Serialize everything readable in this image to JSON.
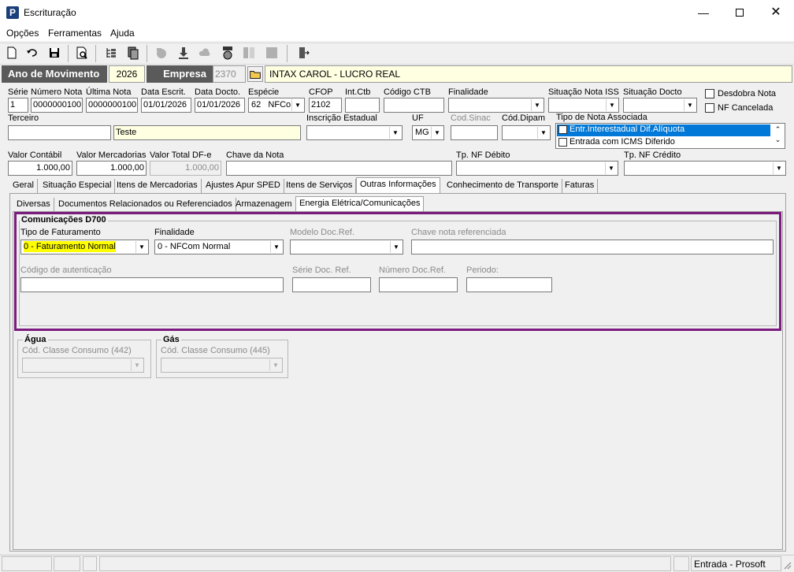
{
  "window": {
    "title": "Escrituração",
    "icon_letter": "P"
  },
  "menu": [
    "Opções",
    "Ferramentas",
    "Ajuda"
  ],
  "header": {
    "ano_label": "Ano de Movimento",
    "ano_value": "2026",
    "empresa_label": "Empresa",
    "empresa_code": "2370",
    "empresa_name": "INTAX CAROL - LUCRO REAL"
  },
  "fields": {
    "serie": {
      "label": "Série",
      "value": "1"
    },
    "numero_nota": {
      "label": "Número Nota",
      "value": "0000000100"
    },
    "ultima_nota": {
      "label": "Última Nota",
      "value": "0000000100"
    },
    "data_escrit": {
      "label": "Data Escrit.",
      "value": "01/01/2026"
    },
    "data_docto": {
      "label": "Data Docto.",
      "value": "01/01/2026"
    },
    "especie": {
      "label": "Espécie",
      "value": "62   NFCo"
    },
    "cfop": {
      "label": "CFOP",
      "value": "2102"
    },
    "int_ctb": {
      "label": "Int.Ctb",
      "value": ""
    },
    "codigo_ctb": {
      "label": "Código CTB",
      "value": ""
    },
    "finalidade": {
      "label": "Finalidade",
      "value": ""
    },
    "situacao_iss": {
      "label": "Situação Nota ISS",
      "value": ""
    },
    "situacao_docto": {
      "label": "Situação Docto",
      "value": ""
    },
    "desdobra_nota": {
      "label": "Desdobra Nota"
    },
    "nf_cancelada": {
      "label": "NF Cancelada"
    },
    "terceiro": {
      "label": "Terceiro",
      "code": "",
      "name": "Teste"
    },
    "inscricao_estadual": {
      "label": "Inscrição Estadual",
      "value": ""
    },
    "uf": {
      "label": "UF",
      "value": "MG"
    },
    "cod_sinac": {
      "label": "Cod.Sinac",
      "value": ""
    },
    "cod_dipam": {
      "label": "Cód.Dipam",
      "value": ""
    },
    "tipo_nota_associada": {
      "label": "Tipo de Nota Associada",
      "items": [
        "Entr.Interestadual Dif.Alíquota",
        "Entrada com ICMS Diferido"
      ]
    },
    "valor_contabil": {
      "label": "Valor Contábil",
      "value": "1.000,00"
    },
    "valor_mercadorias": {
      "label": "Valor Mercadorias",
      "value": "1.000,00"
    },
    "valor_total_dfe": {
      "label": "Valor Total DF-e",
      "value": "1.000,00"
    },
    "chave_nota": {
      "label": "Chave da Nota",
      "value": ""
    },
    "tp_nf_debito": {
      "label": "Tp. NF Débito",
      "value": ""
    },
    "tp_nf_credito": {
      "label": "Tp. NF Crédito",
      "value": ""
    }
  },
  "tabs": [
    "Geral",
    "Situação Especial",
    "Itens de Mercadorias",
    "Ajustes Apur SPED",
    "Itens de Serviços",
    "Outras Informações",
    "Conhecimento de Transporte",
    "Faturas"
  ],
  "subtabs": [
    "Diversas",
    "Documentos Relacionados ou Referenciados",
    "Armazenagem",
    "Energia Elétrica/Comunicações"
  ],
  "d700": {
    "title": "Comunicações D700",
    "tipo_faturamento": {
      "label": "Tipo de Faturamento",
      "value": "0 - Faturamento Normal"
    },
    "finalidade": {
      "label": "Finalidade",
      "value": "0 - NFCom Normal"
    },
    "modelo_doc_ref": {
      "label": "Modelo Doc.Ref.",
      "value": ""
    },
    "chave_nota_ref": {
      "label": "Chave nota referenciada",
      "value": ""
    },
    "codigo_autenticacao": {
      "label": "Código de autenticação",
      "value": ""
    },
    "serie_doc_ref": {
      "label": "Série Doc. Ref.",
      "value": ""
    },
    "numero_doc_ref": {
      "label": "Número Doc.Ref.",
      "value": ""
    },
    "periodo": {
      "label": "Periodo:",
      "value": ""
    }
  },
  "agua": {
    "title": "Água",
    "label": "Cód. Classe Consumo (442)"
  },
  "gas": {
    "title": "Gás",
    "label": "Cód. Classe Consumo (445)"
  },
  "status": {
    "right": "Entrada - Prosoft"
  },
  "colors": {
    "header_bg": "#5a5a5a",
    "highlight": "#ffff00",
    "frame": "#7b1b7e",
    "selection": "#0078d7"
  }
}
